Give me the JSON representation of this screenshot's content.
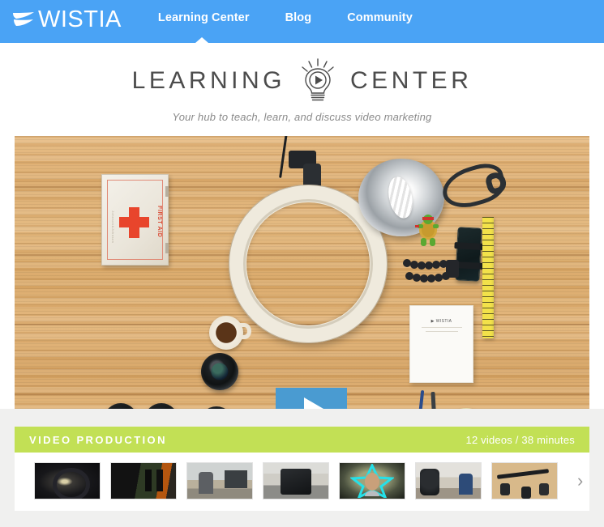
{
  "nav": {
    "brand": "WISTIA",
    "brand_icon": "wistia-flag-logo",
    "links": [
      {
        "label": "Learning Center",
        "active": true
      },
      {
        "label": "Blog",
        "active": false
      },
      {
        "label": "Community",
        "active": false
      }
    ]
  },
  "header": {
    "title_left": "LEARNING",
    "title_right": "CENTER",
    "bulb_icon": "lightbulb-play-icon",
    "tagline": "Your hub to teach, learn, and discuss video marketing"
  },
  "hero": {
    "alt": "Flat-lay of video production gear on a wood desk",
    "play_icon": "play-triangle-icon",
    "play_label": "Play video"
  },
  "section": {
    "title": "VIDEO PRODUCTION",
    "meta": "12 videos / 38 minutes",
    "next_arrow": "chevron-right-icon",
    "thumbnails": [
      {
        "id": "t1",
        "alt": "Ring light in dark studio"
      },
      {
        "id": "t2",
        "alt": "Studio lighting setup with green screen"
      },
      {
        "id": "t3",
        "alt": "Man holding a sign in an office"
      },
      {
        "id": "t4",
        "alt": "Camera rig on tripod in a room"
      },
      {
        "id": "t5",
        "alt": "Man with cyan star graphic"
      },
      {
        "id": "t6",
        "alt": "Camera filming two people"
      },
      {
        "id": "t7",
        "alt": "Gear laid out on wood with a hand"
      }
    ]
  },
  "colors": {
    "nav_blue": "#4aa3f5",
    "section_green": "#c2e055",
    "play_blue": "#4a9bd1",
    "page_bg": "#f0f0ef",
    "title_gray": "#4c4c4c",
    "tagline_gray": "#8a8a8a"
  }
}
